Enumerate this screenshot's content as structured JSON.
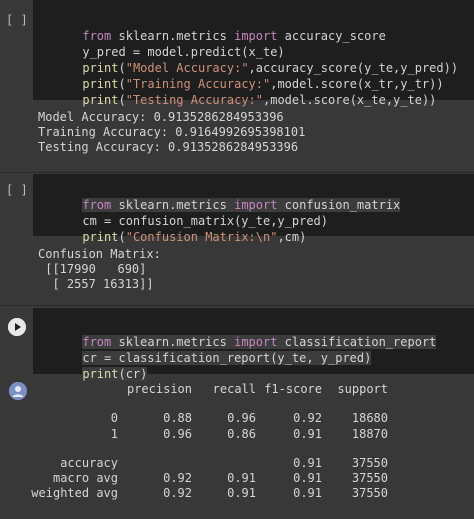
{
  "cell1": {
    "bracket": "[ ]",
    "lines": [
      [
        "from",
        " sklearn.metrics ",
        "import",
        " accuracy_score"
      ],
      [
        "y_pred = model.predict(x_te)"
      ],
      [
        "print",
        "(",
        "\"Model Accuracy:\"",
        ",accuracy_score(y_te,y_pred))"
      ],
      [
        "print",
        "(",
        "\"Training Accuracy:\"",
        ",model.score(x_tr,y_tr))"
      ],
      [
        "print",
        "(",
        "\"Testing Accuracy:\"",
        ",model.score(x_te,y_te))"
      ]
    ],
    "output": [
      "Model Accuracy: 0.9135286284953396",
      "Training Accuracy: 0.9164992695398101",
      "Testing Accuracy: 0.9135286284953396"
    ]
  },
  "cell2": {
    "bracket": "[ ]",
    "lines": [
      [
        "from",
        " sklearn.metrics ",
        "import",
        " confusion_matrix"
      ],
      [
        "cm = confusion_matrix(y_te,y_pred)"
      ],
      [
        "print",
        "(",
        "\"Confusion Matrix:\\n\"",
        ",cm)"
      ]
    ],
    "output": [
      "Confusion Matrix:",
      " [[17990   690]",
      "  [ 2557 16313]]"
    ]
  },
  "cell3": {
    "lines": [
      [
        "from",
        " sklearn.metrics ",
        "import",
        " classification_report"
      ],
      [
        "cr = classification_report(y_te, y_pred)"
      ],
      [
        "print",
        "(cr)"
      ]
    ],
    "report": {
      "headers": [
        "precision",
        "recall",
        "f1-score",
        "support"
      ],
      "rows": [
        {
          "label": "0",
          "precision": "0.88",
          "recall": "0.96",
          "f1": "0.92",
          "support": "18680"
        },
        {
          "label": "1",
          "precision": "0.96",
          "recall": "0.86",
          "f1": "0.91",
          "support": "18870"
        },
        {
          "label": "accuracy",
          "precision": "",
          "recall": "",
          "f1": "0.91",
          "support": "37550"
        },
        {
          "label": "macro avg",
          "precision": "0.92",
          "recall": "0.91",
          "f1": "0.91",
          "support": "37550"
        },
        {
          "label": "weighted avg",
          "precision": "0.92",
          "recall": "0.91",
          "f1": "0.91",
          "support": "37550"
        }
      ]
    }
  },
  "colors": {
    "keyword": "#c586c0",
    "function": "#dcdcaa",
    "string": "#ce9178",
    "code_bg": "#1e1e1e",
    "output_bg": "#383838"
  },
  "icons": {
    "run": "play-icon",
    "output": "output-avatar-icon"
  }
}
